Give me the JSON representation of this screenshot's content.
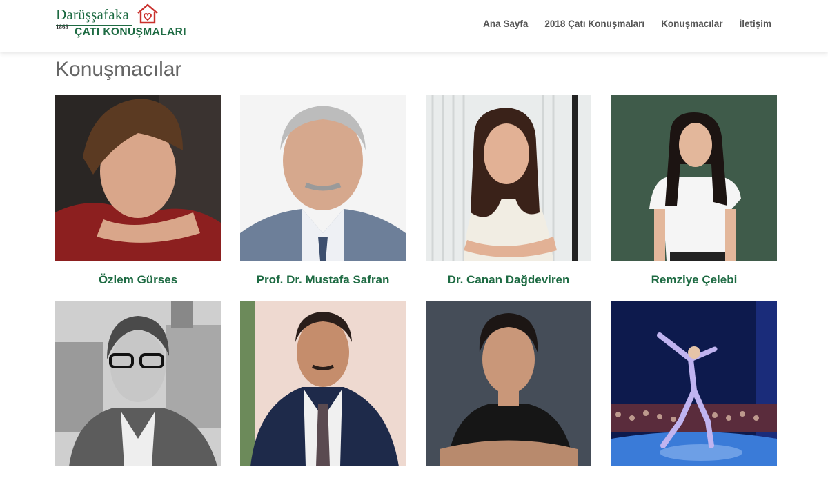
{
  "brand": {
    "name": "Darüşşafaka",
    "year": "1863",
    "tagline": "ÇATI KONUŞMALARI",
    "icon": "house-heart-icon"
  },
  "nav": {
    "items": [
      {
        "label": "Ana Sayfa"
      },
      {
        "label": "2018 Çatı Konuşmaları"
      },
      {
        "label": "Konuşmacılar"
      },
      {
        "label": "İletişim"
      }
    ]
  },
  "page": {
    "title": "Konuşmacılar"
  },
  "speakers": [
    {
      "name": "Özlem Gürses"
    },
    {
      "name": "Prof. Dr. Mustafa Safran"
    },
    {
      "name": "Dr. Canan Dağdeviren"
    },
    {
      "name": "Remziye Çelebi"
    },
    {
      "name": ""
    },
    {
      "name": ""
    },
    {
      "name": ""
    },
    {
      "name": ""
    }
  ],
  "colors": {
    "brand_green": "#1e6b43",
    "nav_text": "#555555",
    "house_red": "#c9302c"
  }
}
